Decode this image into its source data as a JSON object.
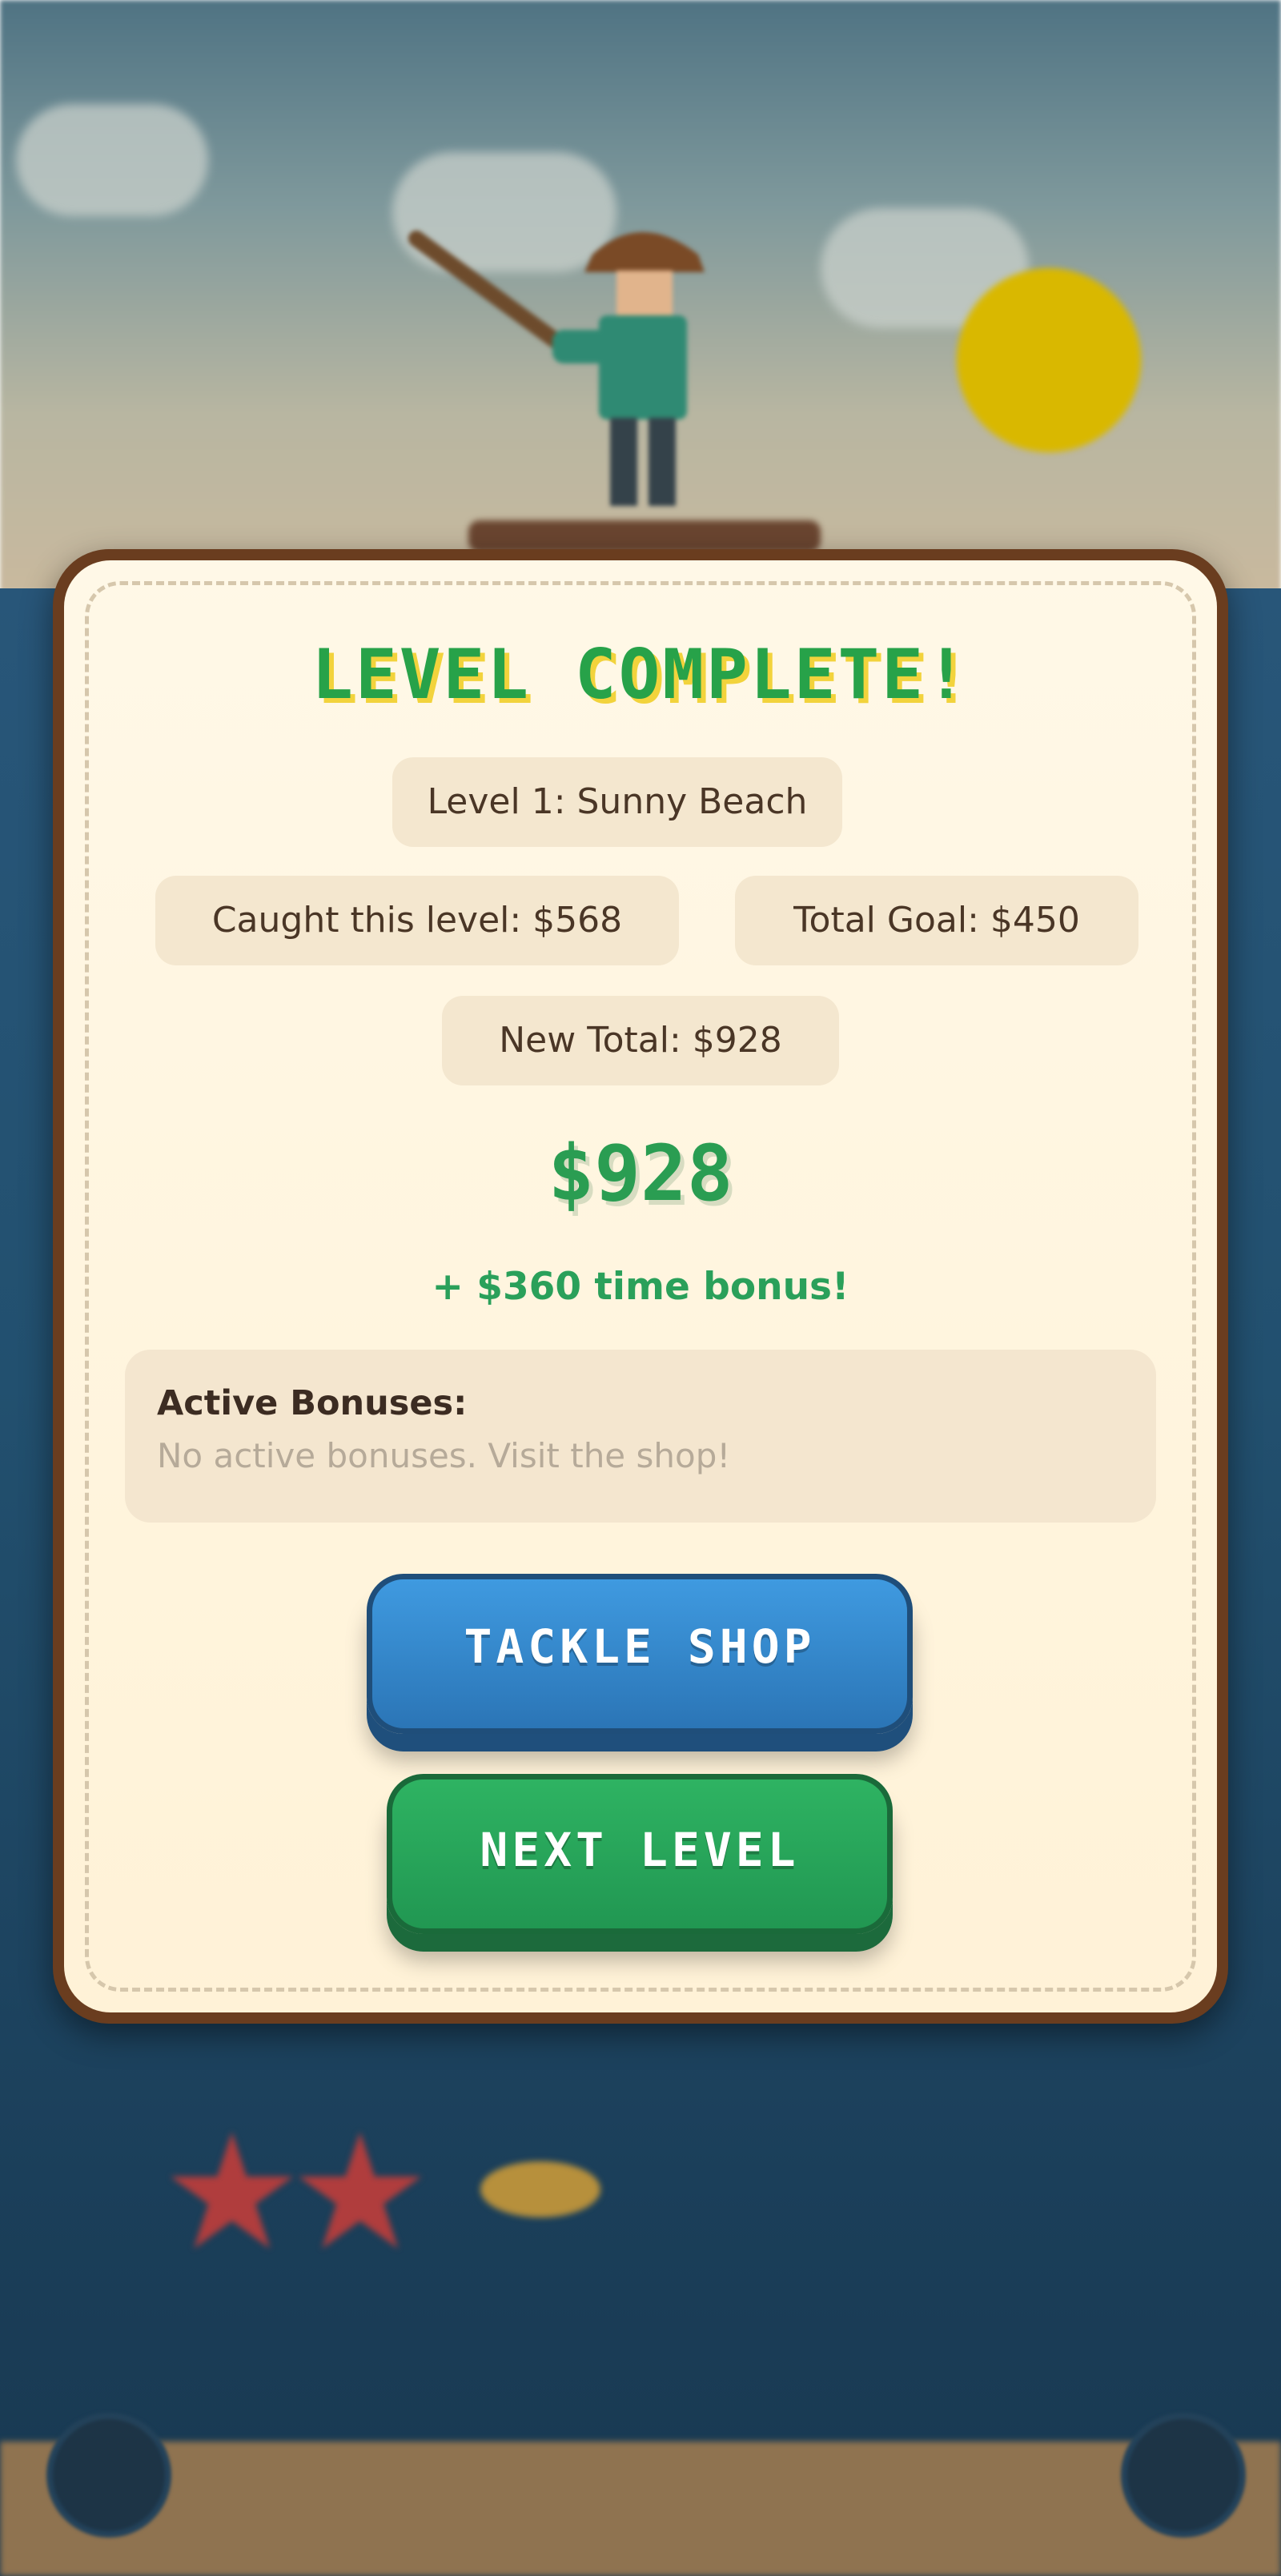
{
  "modal": {
    "title": "LEVEL COMPLETE!",
    "level_name": "Level 1: Sunny Beach",
    "caught": "Caught this level: $568",
    "goal": "Total Goal: $450",
    "new_total": "New Total: $928",
    "big_total": "$928",
    "time_bonus": "+ $360 time bonus!",
    "bonuses": {
      "title": "Active Bonuses:",
      "empty": "No active bonuses. Visit the shop!"
    },
    "buttons": {
      "shop": "TACKLE SHOP",
      "next": "NEXT LEVEL"
    }
  },
  "background": {
    "stars_shown": 2,
    "icons": [
      "music-icon",
      "settings-icon"
    ]
  },
  "colors": {
    "title_green": "#27a249",
    "title_shadow": "#f2d33c",
    "modal_border": "#6a3d1f",
    "modal_fill": "#fff8e7",
    "shop_button": "#2b75b6",
    "next_button": "#219752"
  }
}
